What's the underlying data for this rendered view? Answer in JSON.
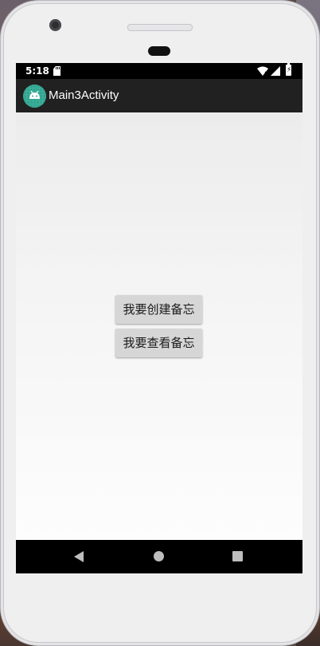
{
  "status_bar": {
    "time": "5:18",
    "icons": [
      "sd-card-icon",
      "wifi-icon",
      "signal-icon",
      "battery-charging-icon"
    ]
  },
  "app_bar": {
    "icon": "android-app-icon",
    "title": "Main3Activity"
  },
  "main": {
    "create_button_label": "我要创建备忘",
    "view_button_label": "我要查看备忘"
  },
  "nav_bar": {
    "icons": [
      "back-icon",
      "home-icon",
      "recents-icon"
    ]
  },
  "colors": {
    "app_bar": "#212121",
    "status_bar": "#000000",
    "button": "#d6d6d6",
    "app_icon": "#2fa690"
  }
}
